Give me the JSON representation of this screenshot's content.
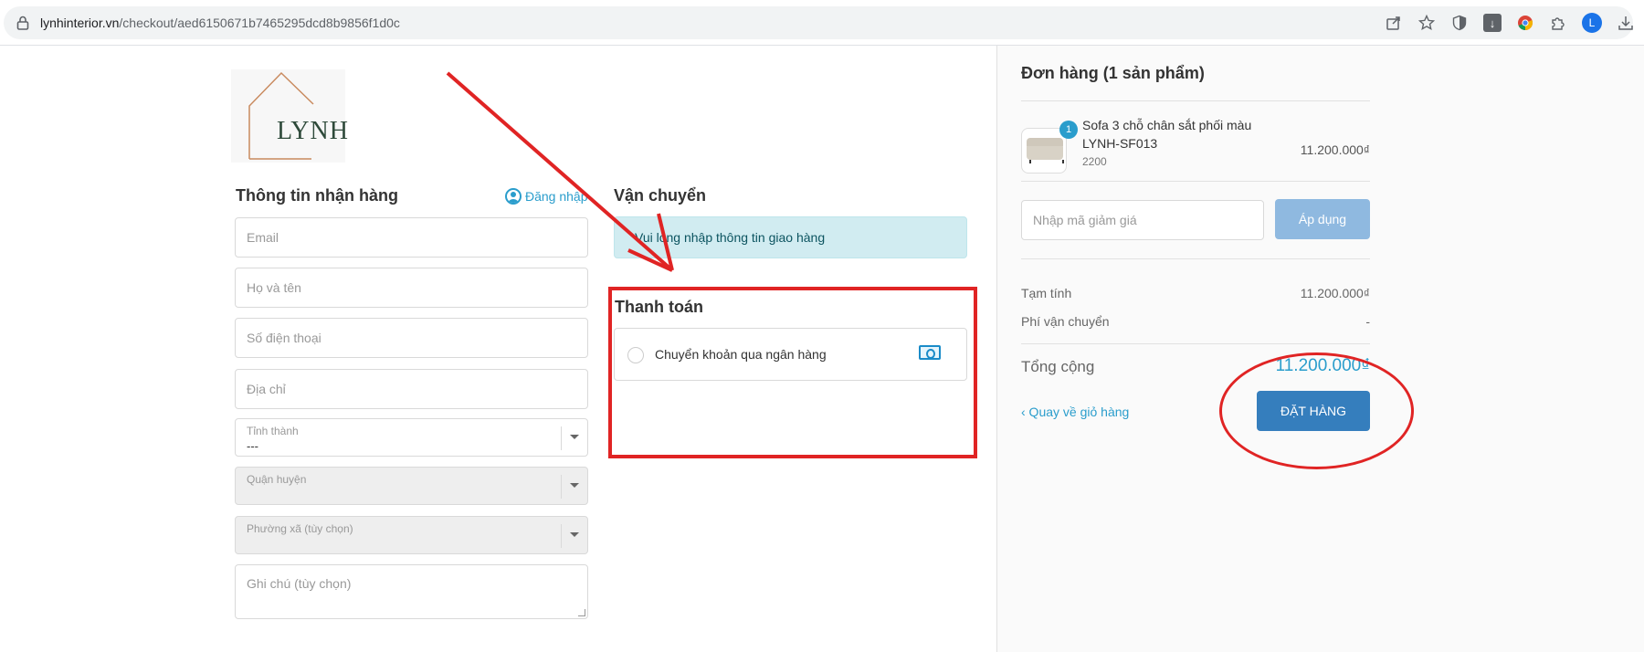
{
  "browser": {
    "url_host": "lynhinterior.vn",
    "url_path": "/checkout/aed6150671b7465295dcd8b9856f1d0c",
    "icons": [
      "share-icon",
      "star-icon",
      "shield-icon",
      "download-box-icon",
      "chrome-icon",
      "puzzle-icon",
      "profile-avatar",
      "download-icon"
    ],
    "avatar_letter": "L"
  },
  "logo": {
    "text": "LYNH"
  },
  "customer_info": {
    "title": "Thông tin nhận hàng",
    "login_label": "Đăng nhập",
    "email_placeholder": "Email",
    "name_placeholder": "Họ và tên",
    "phone_placeholder": "Số điện thoại",
    "address_placeholder": "Địa chỉ",
    "province": {
      "label": "Tỉnh thành",
      "value": "---"
    },
    "district": {
      "label": "Quận huyện",
      "value": ""
    },
    "ward": {
      "label": "Phường xã (tùy chọn)",
      "value": ""
    },
    "note_placeholder": "Ghi chú (tùy chọn)"
  },
  "shipping": {
    "title": "Vận chuyển",
    "notice": "Vui lòng nhập thông tin giao hàng"
  },
  "payment": {
    "title": "Thanh toán",
    "method_label": "Chuyển khoản qua ngân hàng",
    "method_icon": "money-icon"
  },
  "order": {
    "title": "Đơn hàng (1 sản phẩm)",
    "item": {
      "quantity": "1",
      "name": "Sofa 3 chỗ chân sắt phối màu LYNH-SF013",
      "variant": "2200",
      "price": "11.200.000₫"
    },
    "discount_placeholder": "Nhập mã giảm giá",
    "apply_label": "Áp dụng",
    "subtotal_label": "Tạm tính",
    "subtotal_value": "11.200.000₫",
    "shipping_label": "Phí vận chuyển",
    "shipping_value": "-",
    "total_label": "Tổng cộng",
    "total_value": "11.200.000₫",
    "back_label": "‹ Quay về giỏ hàng",
    "place_order_label": "ĐẶT HÀNG"
  },
  "colors": {
    "accent": "#2a9dcc",
    "primary_button": "#357ebd",
    "annotation": "#e02424"
  }
}
